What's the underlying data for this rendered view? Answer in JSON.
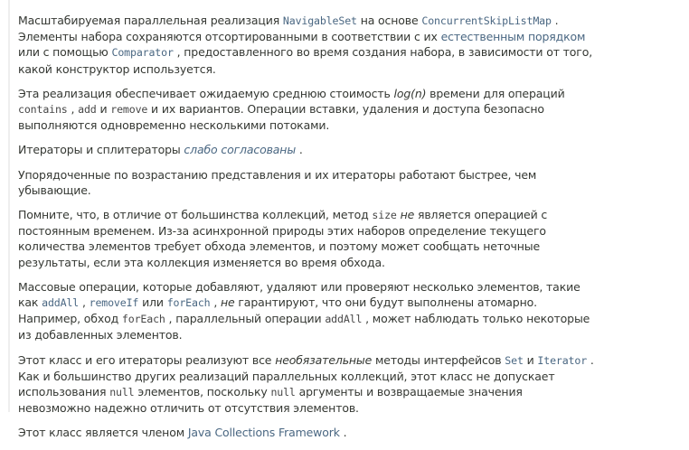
{
  "paragraphs": [
    {
      "id": "intro",
      "parts": [
        {
          "t": "Масштабируемая параллельная реализация "
        },
        {
          "t": "NavigableSet",
          "code": true,
          "link": true
        },
        {
          "t": " на основе "
        },
        {
          "t": "ConcurrentSkipListMap",
          "code": true,
          "link": true
        },
        {
          "t": " . Элементы набора сохраняются отсортированными в соответствии с их "
        },
        {
          "t": "естественным порядком",
          "link": true
        },
        {
          "t": " или с помощью "
        },
        {
          "t": "Comparator",
          "code": true,
          "link": true
        },
        {
          "t": " , предоставленного во время создания набора, в зависимости от того, какой конструктор используется."
        }
      ]
    },
    {
      "id": "cost",
      "parts": [
        {
          "t": "Эта реализация обеспечивает ожидаемую среднюю стоимость "
        },
        {
          "t": "log(n)",
          "em": true
        },
        {
          "t": " времени для операций "
        },
        {
          "t": "contains",
          "code": true
        },
        {
          "t": " , "
        },
        {
          "t": "add",
          "code": true
        },
        {
          "t": " и "
        },
        {
          "t": "remove",
          "code": true
        },
        {
          "t": " и их вариантов. Операции вставки, удаления и доступа безопасно выполняются одновременно несколькими потоками."
        }
      ]
    },
    {
      "id": "iterators",
      "parts": [
        {
          "t": "Итераторы и сплитераторы "
        },
        {
          "t": "слабо согласованы",
          "em": true,
          "link": true
        },
        {
          "t": " ."
        }
      ]
    },
    {
      "id": "ascending",
      "parts": [
        {
          "t": "Упорядоченные по возрастанию представления и их итераторы работают быстрее, чем убывающие."
        }
      ]
    },
    {
      "id": "size",
      "parts": [
        {
          "t": "Помните, что, в отличие от большинства коллекций, метод "
        },
        {
          "t": "size",
          "code": true
        },
        {
          "t": " "
        },
        {
          "t": "не",
          "em": true
        },
        {
          "t": " является операцией с постоянным временем. Из-за асинхронной природы этих наборов определение текущего количества элементов требует обхода элементов, и поэтому может сообщать неточные результаты, если эта коллекция изменяется во время обхода."
        }
      ]
    },
    {
      "id": "bulk",
      "parts": [
        {
          "t": "Массовые операции, которые добавляют, удаляют или проверяют несколько элементов, такие как "
        },
        {
          "t": "addAll",
          "code": true,
          "link": true
        },
        {
          "t": " , "
        },
        {
          "t": "removeIf",
          "code": true,
          "link": true
        },
        {
          "t": " или "
        },
        {
          "t": "forEach",
          "code": true,
          "link": true
        },
        {
          "t": " , "
        },
        {
          "t": "не",
          "em": true
        },
        {
          "t": " гарантируют, что они будут выполнены атомарно. Например, обход "
        },
        {
          "t": "forEach",
          "code": true
        },
        {
          "t": " , параллельный операции "
        },
        {
          "t": "addAll",
          "code": true
        },
        {
          "t": " , может наблюдать только некоторые из добавленных элементов."
        }
      ]
    },
    {
      "id": "optional",
      "parts": [
        {
          "t": "Этот класс и его итераторы реализуют все "
        },
        {
          "t": "необязательные",
          "em": true
        },
        {
          "t": " методы интерфейсов "
        },
        {
          "t": "Set",
          "code": true,
          "link": true
        },
        {
          "t": " и "
        },
        {
          "t": "Iterator",
          "code": true,
          "link": true
        },
        {
          "t": " . Как и большинство других реализаций параллельных коллекций, этот класс не допускает использования "
        },
        {
          "t": "null",
          "code": true
        },
        {
          "t": " элементов, поскольку "
        },
        {
          "t": "null",
          "code": true
        },
        {
          "t": " аргументы и возвращаемые значения невозможно надежно отличить от отсутствия элементов."
        }
      ]
    },
    {
      "id": "framework",
      "parts": [
        {
          "t": "Этот класс является членом "
        },
        {
          "t": "Java Collections Framework",
          "link": true
        },
        {
          "t": " ."
        }
      ]
    }
  ]
}
